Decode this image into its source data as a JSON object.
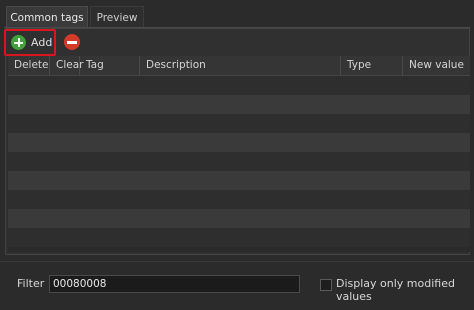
{
  "tabs": [
    {
      "label": "Common tags",
      "active": true
    },
    {
      "label": "Preview",
      "active": false
    }
  ],
  "toolbar": {
    "add_label": "Add",
    "add_icon": "plus-circle-icon",
    "remove_icon": "minus-circle-icon"
  },
  "table": {
    "columns": [
      "Delete",
      "Clear",
      "Tag",
      "Description",
      "Type",
      "New value"
    ],
    "rows": []
  },
  "filter": {
    "label": "Filter",
    "value": "00080008"
  },
  "display_modified": {
    "label": "Display only modified values",
    "checked": false
  },
  "colors": {
    "background": "#2b2b2b",
    "highlight_border": "#d9161e",
    "add_icon": "#3fa33a",
    "remove_icon": "#d23a2a"
  }
}
